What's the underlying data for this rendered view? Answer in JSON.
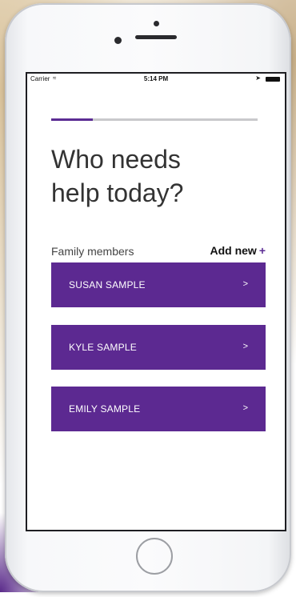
{
  "status_bar": {
    "carrier": "Carrier",
    "wifi_icon": "wifi-icon",
    "time": "5:14 PM",
    "location_icon": "location-icon",
    "battery_icon": "battery-icon"
  },
  "progress": {
    "fraction": 0.2
  },
  "page": {
    "title_line1": "Who needs",
    "title_line2": "help today?"
  },
  "family": {
    "section_label": "Family members",
    "add_new_label": "Add new",
    "add_new_icon": "+",
    "members": [
      {
        "name": "SUSAN SAMPLE",
        "chevron": ">"
      },
      {
        "name": "KYLE SAMPLE",
        "chevron": ">"
      },
      {
        "name": "EMILY SAMPLE",
        "chevron": ">"
      }
    ]
  },
  "colors": {
    "accent": "#5c2991",
    "text": "#333333"
  }
}
